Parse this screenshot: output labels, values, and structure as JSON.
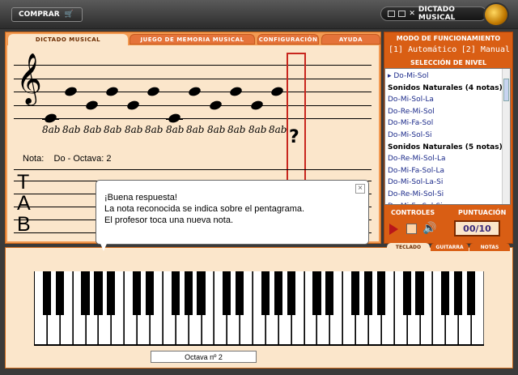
{
  "titlebar": {
    "buy_label": "COMPRAR",
    "cart_icon": "cart-icon",
    "app_title": "DICTADO MUSICAL"
  },
  "tabs": [
    {
      "label": "DICTADO MUSICAL",
      "active": true
    },
    {
      "label": "JUEGO DE MEMORIA MUSICAL",
      "active": false
    },
    {
      "label": "CONFIGURACIÓN",
      "active": false
    },
    {
      "label": "AYUDA",
      "active": false
    }
  ],
  "staff": {
    "note_labels": [
      "8ab",
      "8ab",
      "8ab",
      "8ab",
      "8ab",
      "8ab",
      "8ab",
      "8ab",
      "8ab",
      "8ab",
      "8ab",
      "8ab"
    ],
    "question": "?",
    "note_info_prefix": "Nota:",
    "note_info_value": "Do - Octava: 2",
    "tab_letters": [
      "T",
      "A",
      "B"
    ]
  },
  "tooltip": {
    "line1": "¡Buena respuesta!",
    "line2": "La nota reconocida se indica sobre el pentagrama.",
    "line3": "El profesor toca una nueva nota.",
    "close": "×"
  },
  "side": {
    "mode_title": "MODO DE FUNCIONAMIENTO",
    "mode_auto": "[1] Automático",
    "mode_manual": "[2] Manual",
    "level_title": "SELECCIÓN DE NIVEL",
    "levels": [
      {
        "text": "▸ Do-Mi-Sol",
        "type": "selected"
      },
      {
        "text": "Sonidos Naturales (4 notas):",
        "type": "header"
      },
      {
        "text": "Do-Mi-Sol-La",
        "type": "item"
      },
      {
        "text": "Do-Re-Mi-Sol",
        "type": "item"
      },
      {
        "text": "Do-Mi-Fa-Sol",
        "type": "item"
      },
      {
        "text": "Do-Mi-Sol-Si",
        "type": "item"
      },
      {
        "text": "Sonidos Naturales (5 notas):",
        "type": "header"
      },
      {
        "text": "Do-Re-Mi-Sol-La",
        "type": "item"
      },
      {
        "text": "Do-Mi-Fa-Sol-La",
        "type": "item"
      },
      {
        "text": "Do-Mi-Sol-La-Si",
        "type": "item"
      },
      {
        "text": "Do-Re-Mi-Sol-Si",
        "type": "item"
      },
      {
        "text": "Do-Mi-Fa-Sol-Si",
        "type": "item"
      }
    ],
    "controls_title": "CONTROLES",
    "score_title": "PUNTUACIÓN",
    "score": "00/10"
  },
  "bottom_tabs": [
    {
      "label": "TECLADO",
      "active": true
    },
    {
      "label": "GUITARRA",
      "active": false
    },
    {
      "label": "NOTAS",
      "active": false
    }
  ],
  "keyboard": {
    "white_keys": 35,
    "octave_label": "Octava nº 2"
  },
  "colors": {
    "panel": "#f29a52",
    "paper": "#fbe6cb",
    "side": "#d95e14",
    "highlight": "#c8261e"
  }
}
